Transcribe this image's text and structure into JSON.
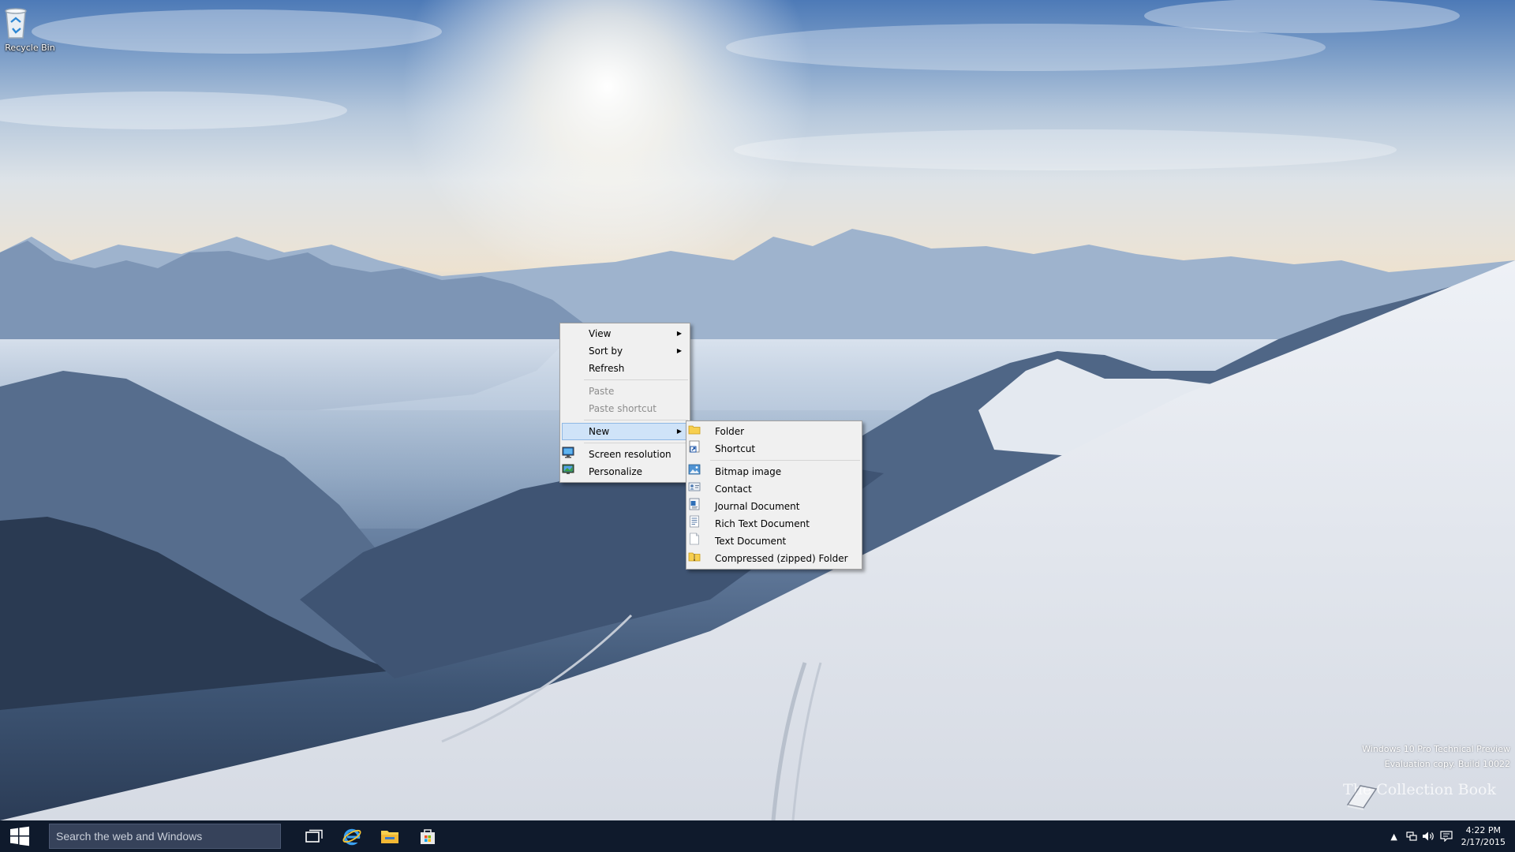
{
  "desktop": {
    "recycle_bin": {
      "label": "Recycle Bin",
      "icon": "recycle-bin-icon"
    }
  },
  "context_menu": {
    "items": [
      {
        "label": "View",
        "submenu": true,
        "disabled": false
      },
      {
        "label": "Sort by",
        "submenu": true,
        "disabled": false
      },
      {
        "label": "Refresh",
        "submenu": false,
        "disabled": false
      },
      {
        "label": "Paste",
        "submenu": false,
        "disabled": true
      },
      {
        "label": "Paste shortcut",
        "submenu": false,
        "disabled": true
      },
      {
        "label": "New",
        "submenu": true,
        "disabled": false,
        "highlighted": true
      },
      {
        "label": "Screen resolution",
        "icon": "display-settings-icon"
      },
      {
        "label": "Personalize",
        "icon": "personalize-icon"
      }
    ]
  },
  "new_submenu": {
    "items": [
      {
        "label": "Folder",
        "icon": "folder-icon"
      },
      {
        "label": "Shortcut",
        "icon": "shortcut-icon"
      },
      {
        "label": "Bitmap image",
        "icon": "bitmap-icon"
      },
      {
        "label": "Contact",
        "icon": "contact-icon"
      },
      {
        "label": "Journal Document",
        "icon": "journal-icon"
      },
      {
        "label": "Rich Text Document",
        "icon": "rich-text-icon"
      },
      {
        "label": "Text Document",
        "icon": "text-document-icon"
      },
      {
        "label": "Compressed (zipped) Folder",
        "icon": "zip-folder-icon"
      }
    ]
  },
  "watermark": {
    "line1": "Windows 10 Pro Technical Preview",
    "line2": "Evaluation copy. Build 10022",
    "logo_text": "The Collection Book"
  },
  "taskbar": {
    "search_placeholder": "Search the web and Windows",
    "apps": [
      "task-view-icon",
      "internet-explorer-icon",
      "file-explorer-icon",
      "store-icon"
    ],
    "clock": {
      "time": "4:22 PM",
      "date": "2/17/2015"
    }
  },
  "colors": {
    "taskbar": "#0f1a2c",
    "menu_background": "#f0f0f0",
    "menu_highlight": "#cfe3f8"
  }
}
